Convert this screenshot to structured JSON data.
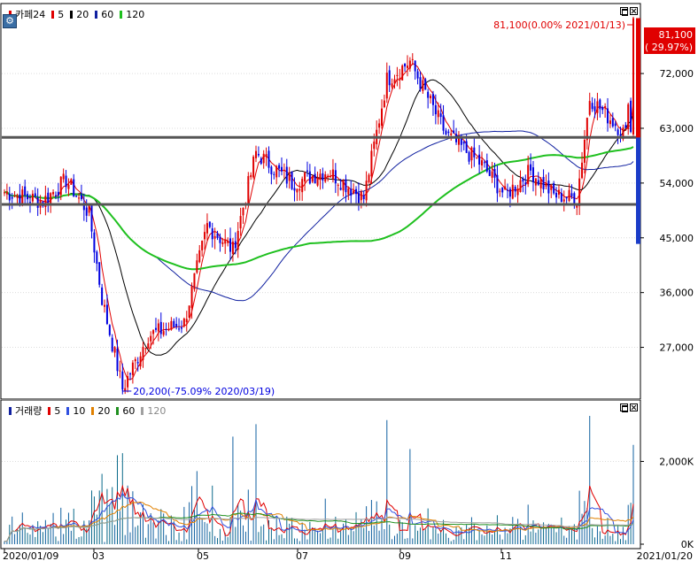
{
  "price_panel": {
    "legend": {
      "stock_name": "카페24",
      "items": [
        {
          "label": "5",
          "color": "#e00000"
        },
        {
          "label": "20",
          "color": "#000000"
        },
        {
          "label": "60",
          "color": "#1020a0"
        },
        {
          "label": "120",
          "color": "#1fc01f"
        }
      ]
    },
    "settings_icon": "gear-icon",
    "y_ticks": [
      "72,000",
      "63,000",
      "54,000",
      "45,000",
      "36,000",
      "27,000"
    ],
    "current_price": "81,100",
    "current_change": "( 29.97%)",
    "max_annotation": "81,100(0.00% 2021/01/13)",
    "min_annotation": "20,200(-75.09% 2020/03/19)",
    "support_lines": [
      61500,
      50500
    ]
  },
  "volume_panel": {
    "legend": {
      "label": "거래량",
      "items": [
        {
          "label": "5",
          "color": "#e00000"
        },
        {
          "label": "10",
          "color": "#3050e0"
        },
        {
          "label": "20",
          "color": "#e08000"
        },
        {
          "label": "60",
          "color": "#209020"
        },
        {
          "label": "120",
          "color": "#a0a0a0"
        }
      ]
    },
    "y_ticks": [
      "2,000K",
      "0K"
    ]
  },
  "x_axis": {
    "labels": [
      "2020/01/09",
      "03",
      "05",
      "07",
      "09",
      "11",
      "2021/01/20"
    ]
  },
  "chart_data": {
    "type": "candlestick",
    "title": "카페24",
    "ylim": [
      18500,
      83500
    ],
    "y_ticks": [
      72000,
      63000,
      54000,
      45000,
      36000,
      27000
    ],
    "close_series": [
      {
        "date": "2020/01/09",
        "close": 52500
      },
      {
        "date": "2020/01/31",
        "close": 51000
      },
      {
        "date": "2020/02/14",
        "close": 54500
      },
      {
        "date": "2020/02/28",
        "close": 49000
      },
      {
        "date": "2020/03/06",
        "close": 35000
      },
      {
        "date": "2020/03/19",
        "close": 20200
      },
      {
        "date": "2020/04/03",
        "close": 29000
      },
      {
        "date": "2020/04/24",
        "close": 31000
      },
      {
        "date": "2020/05/08",
        "close": 47000
      },
      {
        "date": "2020/05/22",
        "close": 43000
      },
      {
        "date": "2020/06/05",
        "close": 59000
      },
      {
        "date": "2020/06/26",
        "close": 54000
      },
      {
        "date": "2020/07/17",
        "close": 56000
      },
      {
        "date": "2020/08/07",
        "close": 51500
      },
      {
        "date": "2020/08/21",
        "close": 71000
      },
      {
        "date": "2020/09/04",
        "close": 74000
      },
      {
        "date": "2020/09/25",
        "close": 62000
      },
      {
        "date": "2020/10/16",
        "close": 57000
      },
      {
        "date": "2020/10/30",
        "close": 52000
      },
      {
        "date": "2020/11/13",
        "close": 56000
      },
      {
        "date": "2020/11/27",
        "close": 52000
      },
      {
        "date": "2020/12/11",
        "close": 51500
      },
      {
        "date": "2020/12/18",
        "close": 68000
      },
      {
        "date": "2021/01/08",
        "close": 62000
      },
      {
        "date": "2021/01/13",
        "close": 81100
      }
    ],
    "series": [
      {
        "name": "5",
        "color": "#e00000"
      },
      {
        "name": "20",
        "color": "#000000"
      },
      {
        "name": "60",
        "color": "#1020a0"
      },
      {
        "name": "120",
        "color": "#1fc01f"
      }
    ]
  }
}
